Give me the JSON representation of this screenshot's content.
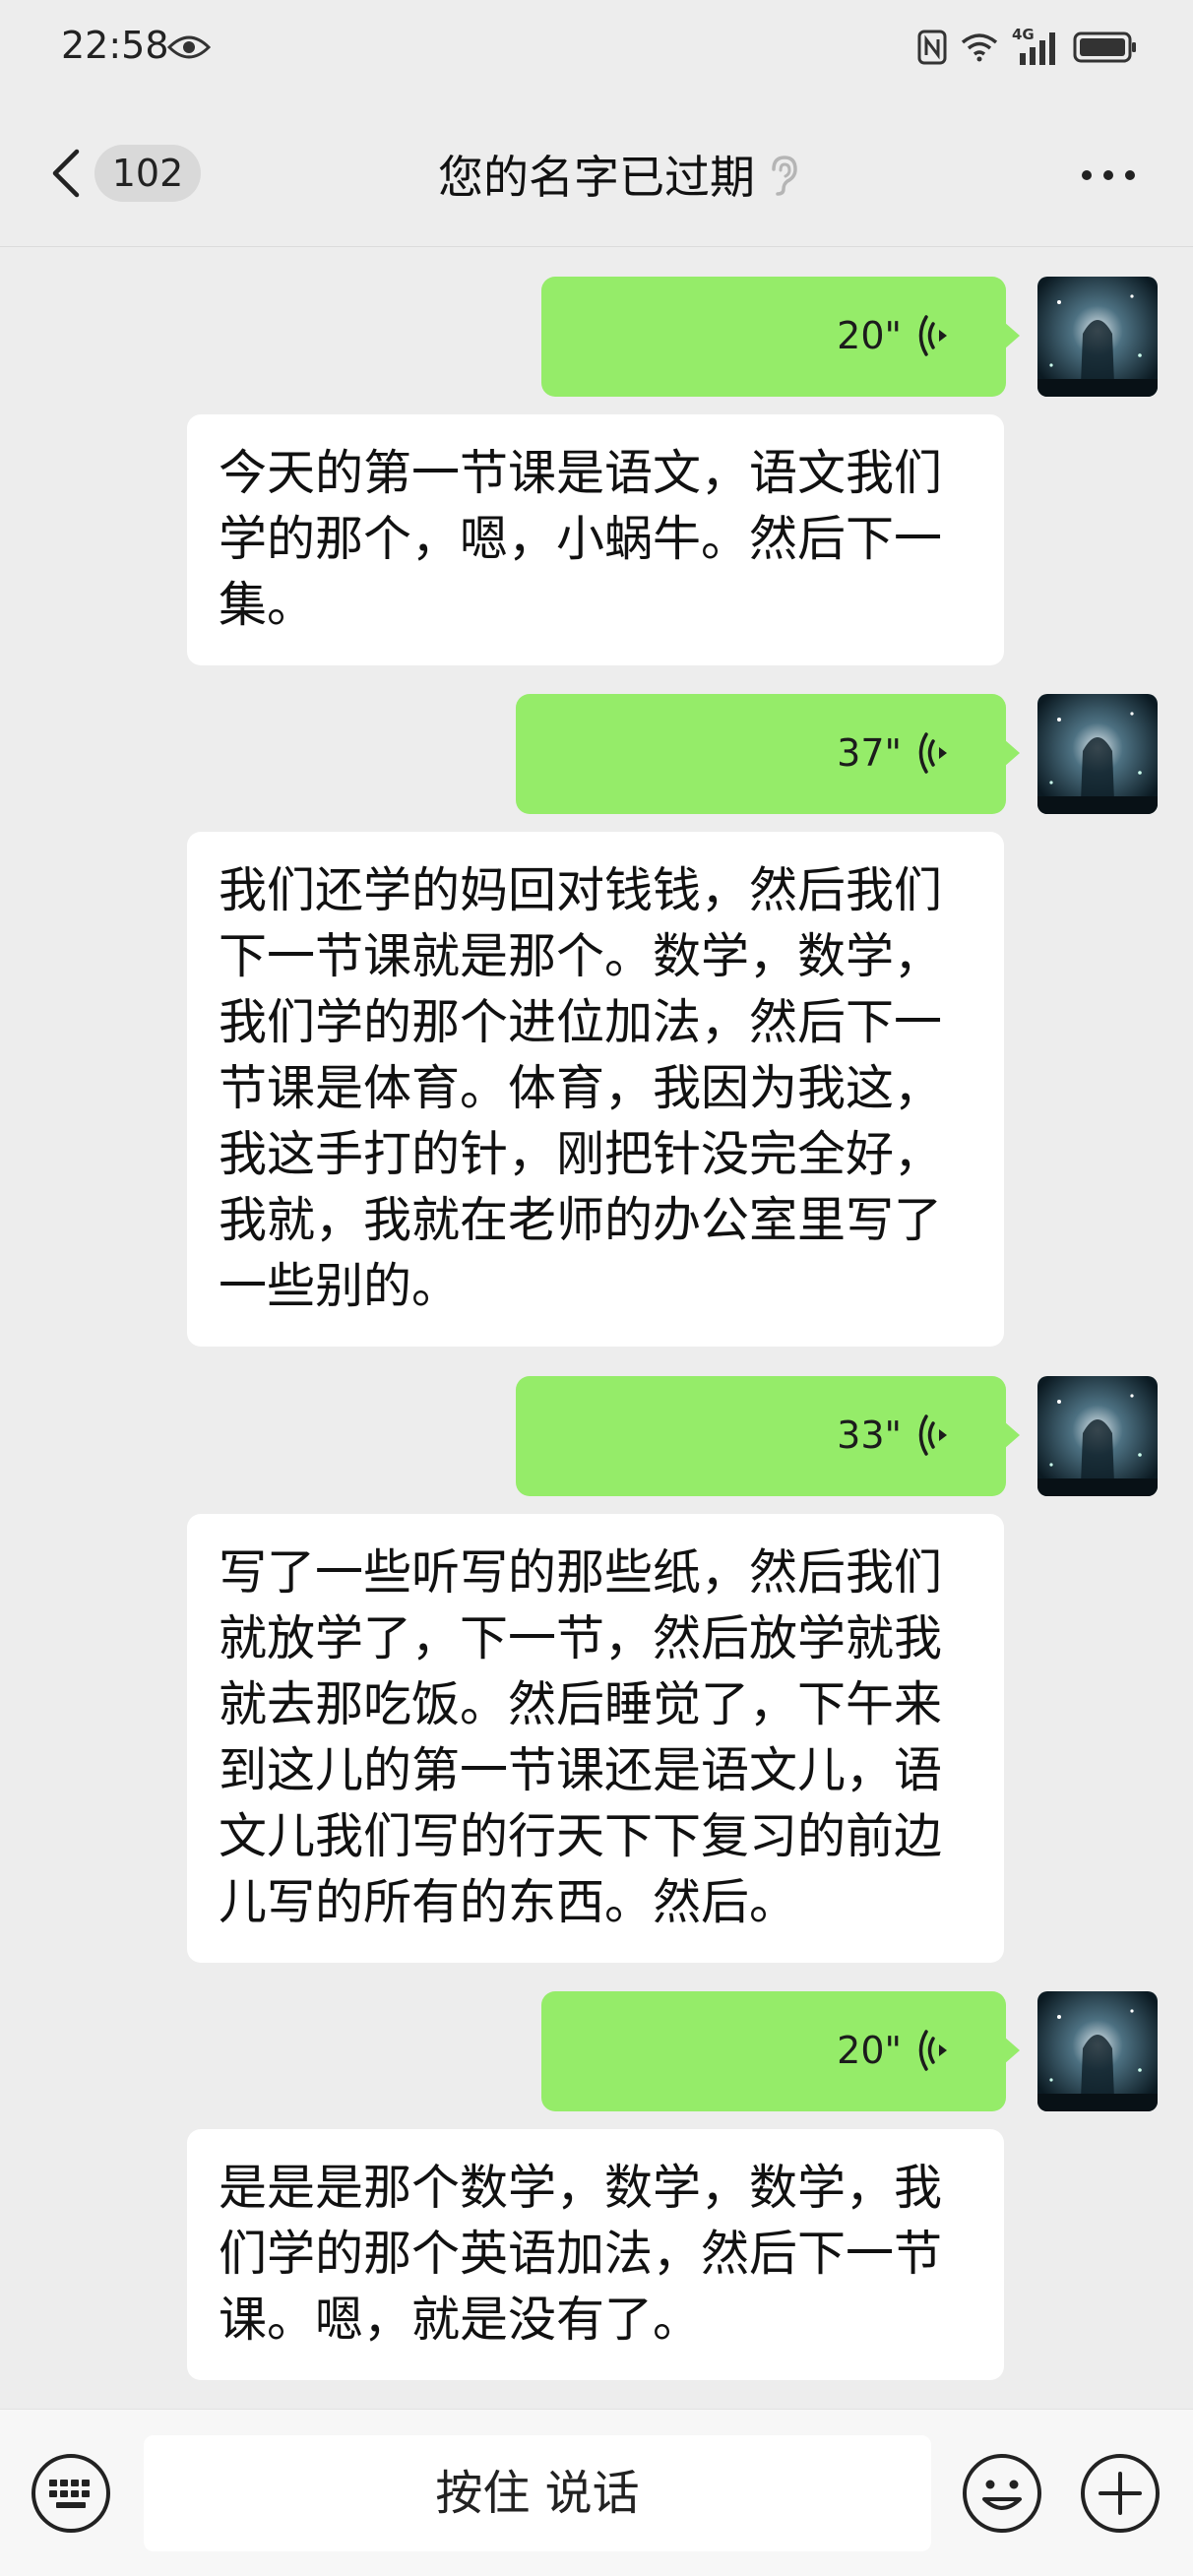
{
  "status_bar": {
    "time": "22:58",
    "network": "4G"
  },
  "header": {
    "unread_count": "102",
    "title": "您的名字已过期"
  },
  "messages": [
    {
      "duration": "20\"",
      "transcript": "今天的第一节课是语文，语文我们学的那个，嗯，小蜗牛。然后下一集。"
    },
    {
      "duration": "37\"",
      "transcript": "我们还学的妈回对钱钱，然后我们下一节课就是那个。数学，数学，我们学的那个进位加法，然后下一节课是体育。体育，我因为我这，我这手打的针，刚把针没完全好，我就，我就在老师的办公室里写了一些别的。"
    },
    {
      "duration": "33\"",
      "transcript": "写了一些听写的那些纸，然后我们就放学了，下一节，然后放学就我就去那吃饭。然后睡觉了，下午来到这儿的第一节课还是语文儿，语文儿我们写的行天下下复习的前边儿写的所有的东西。然后。"
    },
    {
      "duration": "20\"",
      "transcript": "是是是那个数学，数学，数学，我们学的那个英语加法，然后下一节课。嗯，就是没有了。"
    }
  ],
  "input_bar": {
    "hold_to_talk": "按住 说话"
  },
  "colors": {
    "voice_bubble": "#95ec69",
    "background": "#ededed",
    "transcript_bubble": "#ffffff"
  },
  "icons": [
    "eye-icon",
    "nfc-icon",
    "wifi-icon",
    "signal-icon",
    "battery-icon",
    "back-arrow-icon",
    "ear-icon",
    "more-icon",
    "voice-wave-icon",
    "keyboard-icon",
    "emoji-icon",
    "plus-icon"
  ]
}
